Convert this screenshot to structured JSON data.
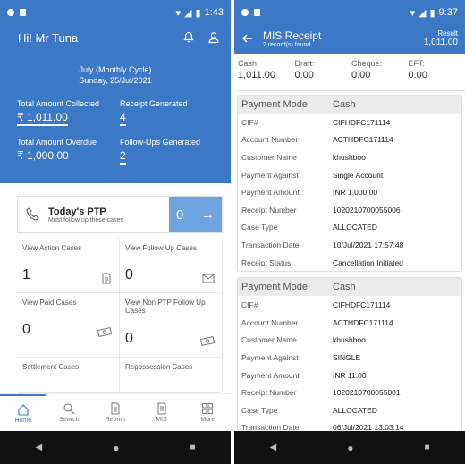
{
  "left": {
    "status": {
      "time": "1:43"
    },
    "header": {
      "greeting": "Hi! Mr Tuna"
    },
    "cycle": {
      "line1": "July (Monthly Cycle)",
      "line2": "Sunday, 25/Jul/2021"
    },
    "summary": {
      "collected_label": "Total Amount Collected",
      "collected_value": "₹ 1,011.00",
      "receipt_label": "Receipt Generated",
      "receipt_value": "4",
      "overdue_label": "Total Amount Overdue",
      "overdue_value": "₹ 1,000.00",
      "followups_label": "Follow-Ups Generated",
      "followups_value": "2"
    },
    "ptp": {
      "title": "Today's PTP",
      "subtitle": "Must follow up these cases",
      "count": "0"
    },
    "cells": [
      {
        "label": "View Action Cases",
        "value": "1",
        "icon": "document-icon"
      },
      {
        "label": "View Follow Up Cases",
        "value": "0",
        "icon": "envelope-icon"
      },
      {
        "label": "View Paid Cases",
        "value": "0",
        "icon": "cash-icon"
      },
      {
        "label": "View Non PTP Follow Up Cases",
        "value": "0",
        "icon": "cash-icon"
      },
      {
        "label": "Settlement Cases"
      },
      {
        "label": "Repossession Cases"
      }
    ],
    "tabs": [
      {
        "label": "Home",
        "icon": "home-icon"
      },
      {
        "label": "Search",
        "icon": "search-icon"
      },
      {
        "label": "Reprint",
        "icon": "reprint-icon"
      },
      {
        "label": "MIS",
        "icon": "mis-icon"
      },
      {
        "label": "More",
        "icon": "grid-icon"
      }
    ]
  },
  "right": {
    "status": {
      "time": "9:37"
    },
    "header": {
      "title": "MIS Receipt",
      "subtitle": "2 record(s) found",
      "result_label": "Result",
      "result_value": "1,011.00"
    },
    "totals": [
      {
        "label": "Cash:",
        "value": "1,011.00"
      },
      {
        "label": "Draft:",
        "value": "0.00"
      },
      {
        "label": "Cheque:",
        "value": "0.00"
      },
      {
        "label": "EFT:",
        "value": "0.00"
      }
    ],
    "receipts": [
      {
        "head_label": "Payment Mode",
        "head_value": "Cash",
        "rows": [
          {
            "label": "CIF#",
            "value": "CIFHDFC171114"
          },
          {
            "label": "Account Number",
            "value": "ACTHDFC171114"
          },
          {
            "label": "Customer Name",
            "value": "khushboo"
          },
          {
            "label": "Payment Against",
            "value": "Single Account"
          },
          {
            "label": "Payment Amount",
            "value": "INR 1,000.00"
          },
          {
            "label": "Receipt Number",
            "value": "1020210700055006"
          },
          {
            "label": "Case Type",
            "value": "ALLOCATED"
          },
          {
            "label": "Transaction Date",
            "value": "10/Jul/2021 17:57:48"
          },
          {
            "label": "Receipt Status",
            "value": "Cancellation Initiated"
          }
        ]
      },
      {
        "head_label": "Payment Mode",
        "head_value": "Cash",
        "rows": [
          {
            "label": "CIF#",
            "value": "CIFHDFC171114"
          },
          {
            "label": "Account Number",
            "value": "ACTHDFC171114"
          },
          {
            "label": "Customer Name",
            "value": "khushboo"
          },
          {
            "label": "Payment Against",
            "value": "SINGLE"
          },
          {
            "label": "Payment Amount",
            "value": "INR 11.00"
          },
          {
            "label": "Receipt Number",
            "value": "1020210700055001"
          },
          {
            "label": "Case Type",
            "value": "ALLOCATED"
          },
          {
            "label": "Transaction Date",
            "value": "06/Jul/2021 13:03:14"
          }
        ]
      }
    ]
  },
  "colors": {
    "primary": "#3d78c6",
    "ptp_accent": "#6fa4de",
    "nav_bar": "#111111"
  }
}
